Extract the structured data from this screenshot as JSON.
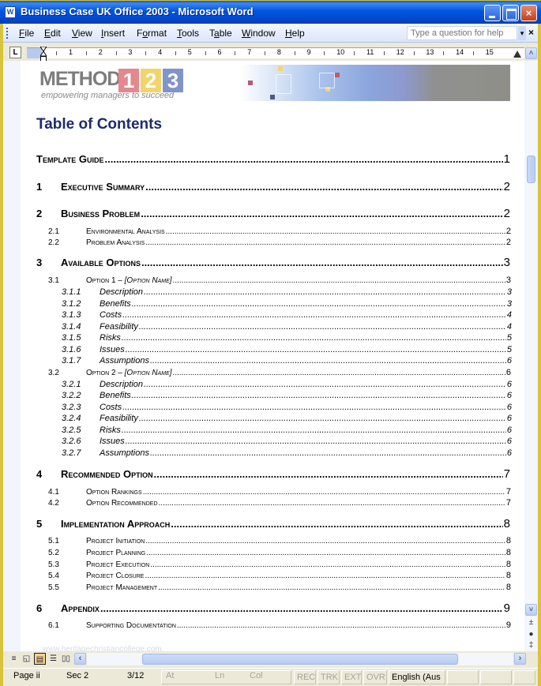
{
  "window": {
    "title": "Business Case UK Office 2003 - Microsoft Word",
    "app_icon": "W",
    "controls": {
      "minimize": "minimize",
      "maximize": "maximize",
      "close": "×"
    }
  },
  "menubar": {
    "items": [
      {
        "pre": "",
        "u": "F",
        "post": "ile"
      },
      {
        "pre": "",
        "u": "E",
        "post": "dit"
      },
      {
        "pre": "",
        "u": "V",
        "post": "iew"
      },
      {
        "pre": "",
        "u": "I",
        "post": "nsert"
      },
      {
        "pre": "F",
        "u": "o",
        "post": "rmat"
      },
      {
        "pre": "",
        "u": "T",
        "post": "ools"
      },
      {
        "pre": "T",
        "u": "a",
        "post": "ble"
      },
      {
        "pre": "",
        "u": "W",
        "post": "indow"
      },
      {
        "pre": "",
        "u": "H",
        "post": "elp"
      }
    ],
    "help_placeholder": "Type a question for help",
    "help_dropdown": "▾",
    "close_doc": "×"
  },
  "ruler": {
    "tab_selector": "L",
    "numbers": [
      "1",
      "2",
      "3",
      "4",
      "5",
      "6",
      "7",
      "8",
      "9",
      "10",
      "11",
      "12",
      "13",
      "14",
      "15"
    ]
  },
  "header": {
    "logo_text": "METHOD",
    "logo_digits": [
      "1",
      "2",
      "3"
    ],
    "tagline": "empowering managers to succeed",
    "brand_colors": {
      "one": "#e4878f",
      "two": "#f2d46a",
      "three": "#7f94c8"
    }
  },
  "toc": {
    "title": "Table of Contents",
    "title_color": "#1e2a6e",
    "entries": [
      {
        "level": 0,
        "num": "",
        "label": "Template Guide",
        "page": "1"
      },
      {
        "level": 1,
        "num": "1",
        "label": "Executive Summary",
        "page": "2"
      },
      {
        "level": 1,
        "num": "2",
        "label": "Business Problem",
        "page": "2"
      },
      {
        "level": 2,
        "num": "2.1",
        "label": "Environmental Analysis",
        "page": "2"
      },
      {
        "level": 2,
        "num": "2.2",
        "label": "Problem Analysis",
        "page": "2"
      },
      {
        "level": 1,
        "num": "3",
        "label": "Available Options",
        "page": "3"
      },
      {
        "level": 2,
        "num": "3.1",
        "label": "Option 1 – ",
        "label_italic": "[Option Name]",
        "page": "3"
      },
      {
        "level": 3,
        "num": "3.1.1",
        "label": "Description",
        "page": "3"
      },
      {
        "level": 3,
        "num": "3.1.2",
        "label": "Benefits",
        "page": "3"
      },
      {
        "level": 3,
        "num": "3.1.3",
        "label": "Costs",
        "page": "4"
      },
      {
        "level": 3,
        "num": "3.1.4",
        "label": "Feasibility",
        "page": "4"
      },
      {
        "level": 3,
        "num": "3.1.5",
        "label": "Risks",
        "page": "5"
      },
      {
        "level": 3,
        "num": "3.1.6",
        "label": "Issues",
        "page": "5"
      },
      {
        "level": 3,
        "num": "3.1.7",
        "label": "Assumptions",
        "page": "6"
      },
      {
        "level": 2,
        "num": "3.2",
        "label": "Option 2 – ",
        "label_italic": "[Option Name]",
        "page": "6"
      },
      {
        "level": 3,
        "num": "3.2.1",
        "label": "Description",
        "page": "6"
      },
      {
        "level": 3,
        "num": "3.2.2",
        "label": "Benefits",
        "page": "6"
      },
      {
        "level": 3,
        "num": "3.2.3",
        "label": "Costs",
        "page": "6"
      },
      {
        "level": 3,
        "num": "3.2.4",
        "label": "Feasibility",
        "page": "6"
      },
      {
        "level": 3,
        "num": "3.2.5",
        "label": "Risks",
        "page": "6"
      },
      {
        "level": 3,
        "num": "3.2.6",
        "label": "Issues",
        "page": "6"
      },
      {
        "level": 3,
        "num": "3.2.7",
        "label": "Assumptions",
        "page": "6"
      },
      {
        "level": 1,
        "num": "4",
        "label": "Recommended Option",
        "page": "7"
      },
      {
        "level": 2,
        "num": "4.1",
        "label": "Option Rankings",
        "page": "7"
      },
      {
        "level": 2,
        "num": "4.2",
        "label": "Option Recommended",
        "page": "7"
      },
      {
        "level": 1,
        "num": "5",
        "label": "Implementation Approach",
        "page": "8"
      },
      {
        "level": 2,
        "num": "5.1",
        "label": "Project Initiation",
        "page": "8"
      },
      {
        "level": 2,
        "num": "5.2",
        "label": "Project Planning",
        "page": "8"
      },
      {
        "level": 2,
        "num": "5.3",
        "label": "Project Execution",
        "page": "8"
      },
      {
        "level": 2,
        "num": "5.4",
        "label": "Project Closure",
        "page": "8"
      },
      {
        "level": 2,
        "num": "5.5",
        "label": "Project Management",
        "page": "8"
      },
      {
        "level": 1,
        "num": "6",
        "label": "Appendix",
        "page": "9"
      },
      {
        "level": 2,
        "num": "6.1",
        "label": "Supporting Documentation",
        "page": "9"
      }
    ]
  },
  "watermark": "www.heritagechristiancollege.com",
  "scrollbar": {
    "up": "˄",
    "down": "˅",
    "prev_page": "±",
    "select_browse": "●",
    "next_page": "‡"
  },
  "viewbar": {
    "buttons": [
      {
        "name": "normal-view",
        "glyph": "≡"
      },
      {
        "name": "web-layout-view",
        "glyph": "◱"
      },
      {
        "name": "print-layout-view",
        "glyph": "▤",
        "active": true
      },
      {
        "name": "outline-view",
        "glyph": "☰"
      },
      {
        "name": "reading-layout-view",
        "glyph": "▯▯"
      }
    ],
    "left": "‹",
    "right": "›"
  },
  "statusbar": {
    "page": "Page  ii",
    "section": "Sec  2",
    "page_count": "3/12",
    "at": "At",
    "line": "Ln",
    "col": "Col",
    "rec": "REC",
    "trk": "TRK",
    "ext": "EXT",
    "ovr": "OVR",
    "language": "English (Aus"
  }
}
